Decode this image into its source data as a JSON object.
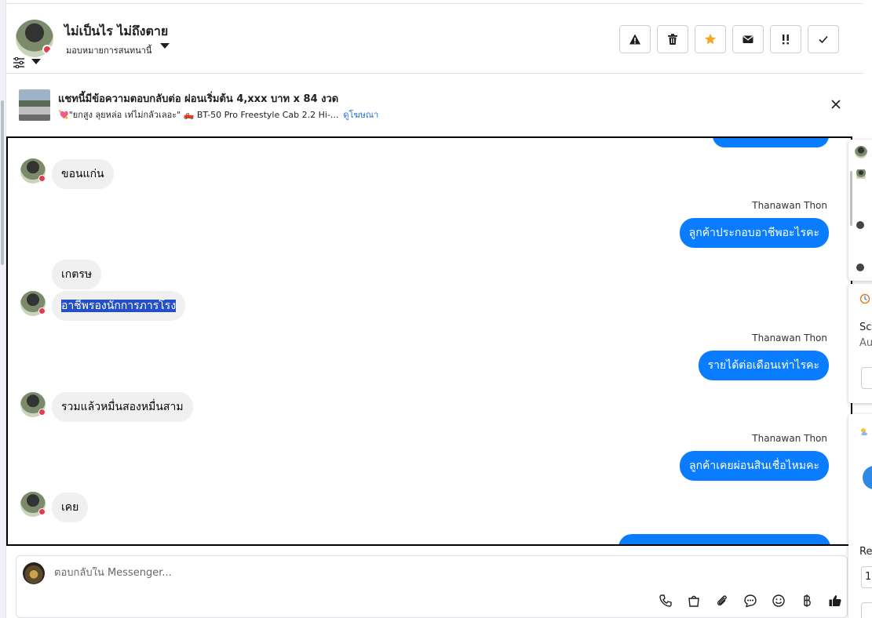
{
  "header": {
    "contact_name": "ไม่เป็นไร ไม่ถึงตาย",
    "assign_label": "มอบหมายการสนทนานี้",
    "actions": [
      {
        "name": "report-button",
        "icon": "warning-icon"
      },
      {
        "name": "delete-button",
        "icon": "trash-icon"
      },
      {
        "name": "star-button",
        "icon": "star-icon"
      },
      {
        "name": "mark-unread-button",
        "icon": "envelope-icon"
      },
      {
        "name": "follow-up-button",
        "icon": "exclamation-icon"
      },
      {
        "name": "done-button",
        "icon": "check-icon"
      }
    ],
    "star_color": "#f5a623"
  },
  "ad_banner": {
    "title": "แชทนี้มีข้อความตอบกลับต่อ ผ่อนเริ่มต้น 4,xxx บาท x 84 งวด",
    "subtitle": "💘\"ยกสูง ลุยหล่อ เท่ไม่กลัวเลอะ\" 🛻 BT-50 Pro Freestyle Cab 2.2 Hi-...",
    "link": "ดูโฆษณา"
  },
  "messages": {
    "m1_in": "ขอนแก่น",
    "s1": "Thanawan Thon",
    "m2_out": "ลูกค้าประกอบอาชีพอะไรคะ",
    "m3_in": "เกตรษ",
    "m4_in": "อาชีพรองนักการภารโรง",
    "s2": "Thanawan Thon",
    "m5_out": "รายได้ต่อเดือนเท่าไรคะ",
    "m6_in": "รวมแล้วหมื่นสองหมื่นสาม",
    "s3": "Thanawan Thon",
    "m7_out": "ลูกค้าเคยผ่อนสินเชื่อไหมคะ",
    "m8_in": "เคย"
  },
  "composer": {
    "placeholder": "ตอบกลับใน Messenger..."
  },
  "side_panel": {
    "text_a": "Sc",
    "text_b": "Au",
    "text_c": "Re",
    "text_d": "1"
  },
  "colors": {
    "outgoing_bubble": "#0a7cff",
    "incoming_bubble": "#f0f0f0",
    "selection": "#2450c7",
    "link": "#216fdb"
  }
}
